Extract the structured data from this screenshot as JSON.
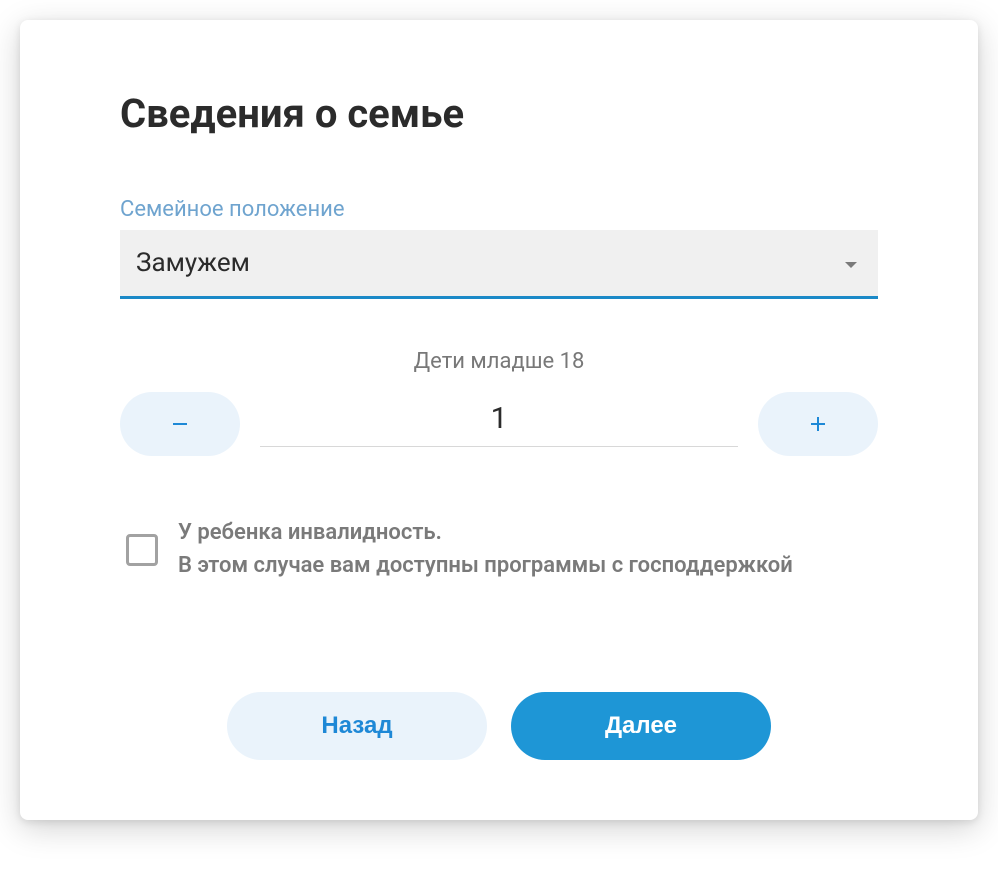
{
  "title": "Сведения о семье",
  "maritalStatus": {
    "label": "Семейное положение",
    "value": "Замужем"
  },
  "children": {
    "label": "Дети младше 18",
    "value": "1"
  },
  "disability": {
    "text": "У ребенка инвалидность.\nВ этом случае вам доступны программы c господдержкой"
  },
  "buttons": {
    "back": "Назад",
    "next": "Далее"
  }
}
